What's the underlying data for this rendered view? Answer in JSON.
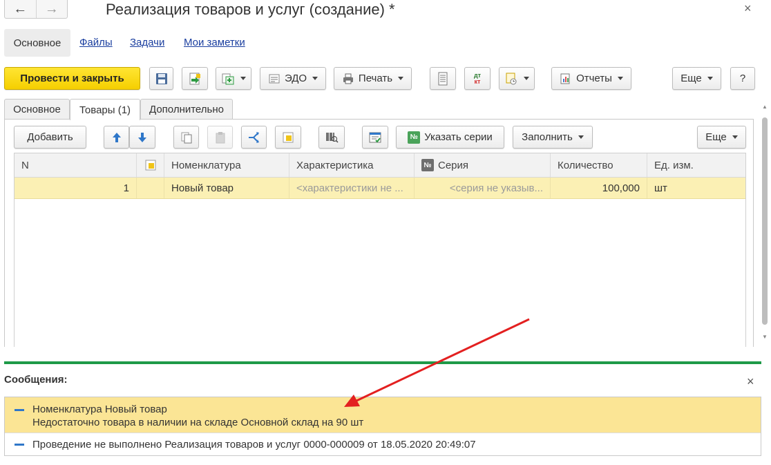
{
  "window": {
    "title": "Реализация товаров и услуг (создание) *",
    "back_icon": "←",
    "forward_icon": "→",
    "close_icon": "×"
  },
  "sections": {
    "active": "Основное",
    "links": [
      "Файлы",
      "Задачи",
      "Мои заметки"
    ]
  },
  "toolbar": {
    "post_close": "Провести и закрыть",
    "edo": "ЭДО",
    "print": "Печать",
    "dt_kt_top": "дт",
    "dt_kt_bottom": "кт",
    "reports": "Отчеты",
    "more": "Еще",
    "help": "?"
  },
  "tabs": [
    "Основное",
    "Товары (1)",
    "Дополнительно"
  ],
  "table_toolbar": {
    "add": "Добавить",
    "specify_series": "Указать серии",
    "fill": "Заполнить",
    "more": "Еще",
    "series_badge": "№"
  },
  "table": {
    "columns": [
      "N",
      "",
      "Номенклатура",
      "Характеристика",
      "Серия",
      "Количество",
      "Ед. изм."
    ],
    "series_col_badge": "№",
    "rows": [
      {
        "n": "1",
        "flag": "",
        "item": "Новый товар",
        "characteristic": "<характеристики не ...",
        "series": "<серия не указыв...",
        "quantity": "100,000",
        "unit": "шт"
      }
    ]
  },
  "messages": {
    "title": "Сообщения:",
    "close_icon": "×",
    "items": [
      {
        "line1": "Номенклатура Новый товар",
        "line2": "Недостаточно товара в наличии на складе Основной склад на 90 шт"
      },
      {
        "line1": "Проведение не выполнено Реализация товаров и услуг 0000-000009 от 18.05.2020 20:49:07"
      }
    ]
  },
  "colors": {
    "primary_button": "#f5cf00",
    "selected_row": "#fbf0b4",
    "message_highlight": "#fbe595",
    "separator": "#1e9a48",
    "arrow": "#e32020",
    "link": "#1a3e9f"
  }
}
